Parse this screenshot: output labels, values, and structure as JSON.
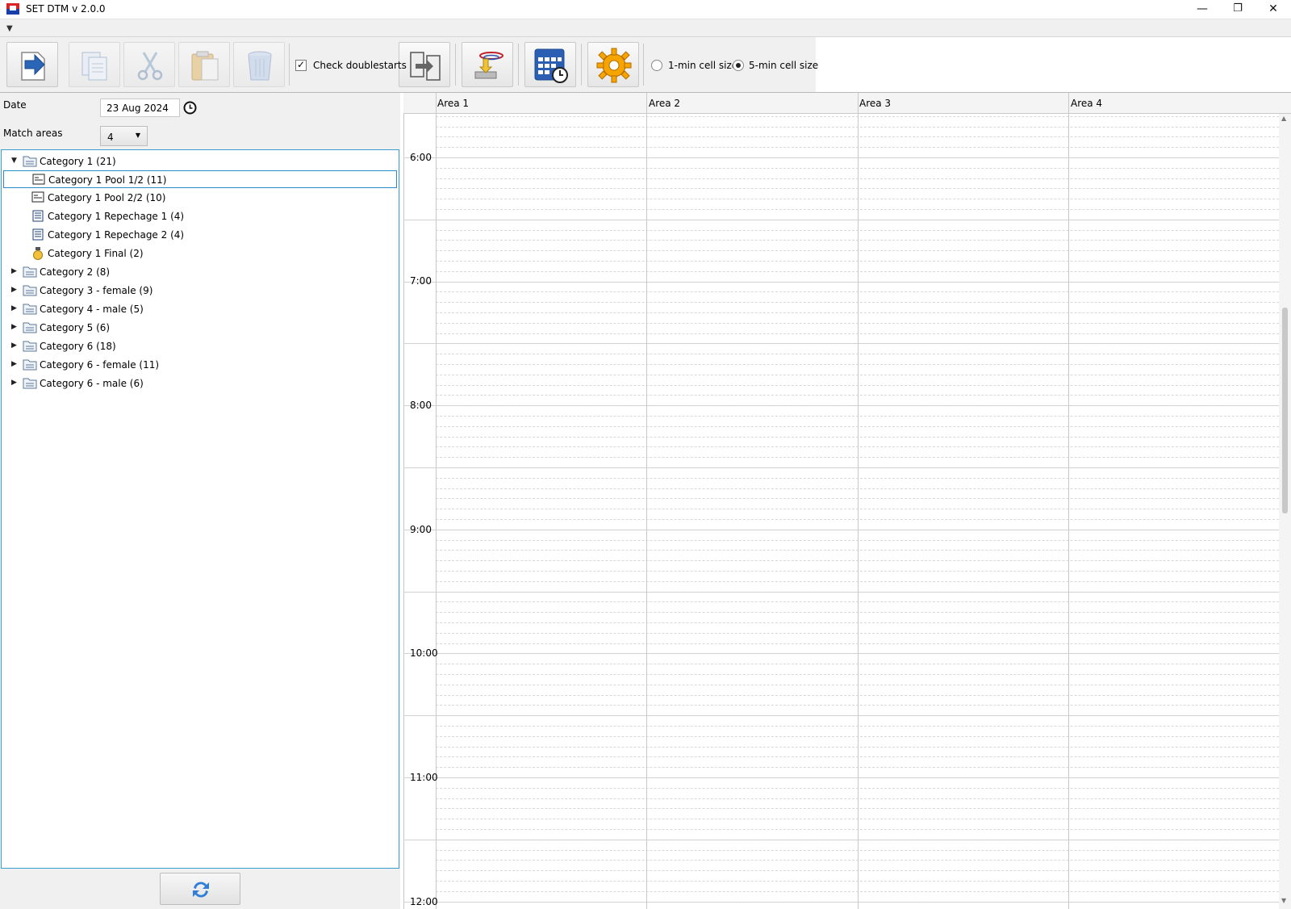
{
  "window": {
    "title": "SET DTM v 2.0.0",
    "minimize": "—",
    "restore": "❐",
    "close": "✕"
  },
  "toolbar": {
    "check_doublestarts_label": "Check doublestarts",
    "check_doublestarts_checked": true,
    "cell_size_1min_label": "1-min cell size",
    "cell_size_5min_label": "5-min cell size",
    "cell_size_selected": "5-min cell size",
    "buttons": [
      {
        "name": "export-button",
        "icon": "arrow-right-icon",
        "enabled": true
      },
      {
        "name": "copy-button",
        "icon": "copy-icon",
        "enabled": false
      },
      {
        "name": "cut-button",
        "icon": "scissors-icon",
        "enabled": false
      },
      {
        "name": "paste-button",
        "icon": "paste-icon",
        "enabled": false
      },
      {
        "name": "delete-button",
        "icon": "trash-icon",
        "enabled": false
      },
      {
        "name": "transfer-button",
        "icon": "transfer-icon",
        "enabled": true
      },
      {
        "name": "import-button",
        "icon": "import-icon",
        "enabled": true
      },
      {
        "name": "schedule-button",
        "icon": "calendar-clock-icon",
        "enabled": true
      },
      {
        "name": "settings-button",
        "icon": "gear-icon",
        "enabled": true
      }
    ]
  },
  "left_panel": {
    "date_label": "Date",
    "date_value": "23 Aug 2024",
    "match_areas_label": "Match areas",
    "match_areas_value": "4",
    "tree": [
      {
        "label": "Category 1 (21)",
        "level": 0,
        "expanded": true,
        "icon": "folder-icon"
      },
      {
        "label": "Category 1 Pool 1/2 (11)",
        "level": 1,
        "icon": "pool-icon",
        "selected": true
      },
      {
        "label": "Category 1 Pool 2/2 (10)",
        "level": 1,
        "icon": "pool-icon"
      },
      {
        "label": "Category 1 Repechage 1 (4)",
        "level": 1,
        "icon": "repechage-icon"
      },
      {
        "label": "Category 1 Repechage 2 (4)",
        "level": 1,
        "icon": "repechage-icon"
      },
      {
        "label": "Category 1 Final (2)",
        "level": 1,
        "icon": "medal-icon"
      },
      {
        "label": "Category 2 (8)",
        "level": 0,
        "expanded": false,
        "icon": "folder-icon"
      },
      {
        "label": "Category 3 - female (9)",
        "level": 0,
        "expanded": false,
        "icon": "folder-icon"
      },
      {
        "label": "Category 4 - male (5)",
        "level": 0,
        "expanded": false,
        "icon": "folder-icon"
      },
      {
        "label": "Category 5 (6)",
        "level": 0,
        "expanded": false,
        "icon": "folder-icon"
      },
      {
        "label": "Category 6 (18)",
        "level": 0,
        "expanded": false,
        "icon": "folder-icon"
      },
      {
        "label": "Category 6 - female (11)",
        "level": 0,
        "expanded": false,
        "icon": "folder-icon"
      },
      {
        "label": "Category 6 - male (6)",
        "level": 0,
        "expanded": false,
        "icon": "folder-icon"
      }
    ]
  },
  "schedule": {
    "areas": [
      "Area 1",
      "Area 2",
      "Area 3",
      "Area 4"
    ],
    "times": [
      "6:00",
      "7:00",
      "8:00",
      "9:00",
      "10:00",
      "11:00",
      "12:00"
    ]
  },
  "colors": {
    "accent": "#2a8cc6",
    "folder": "#8aa7c4",
    "gear": "#f5a400",
    "refresh": "#2f7fd8"
  }
}
